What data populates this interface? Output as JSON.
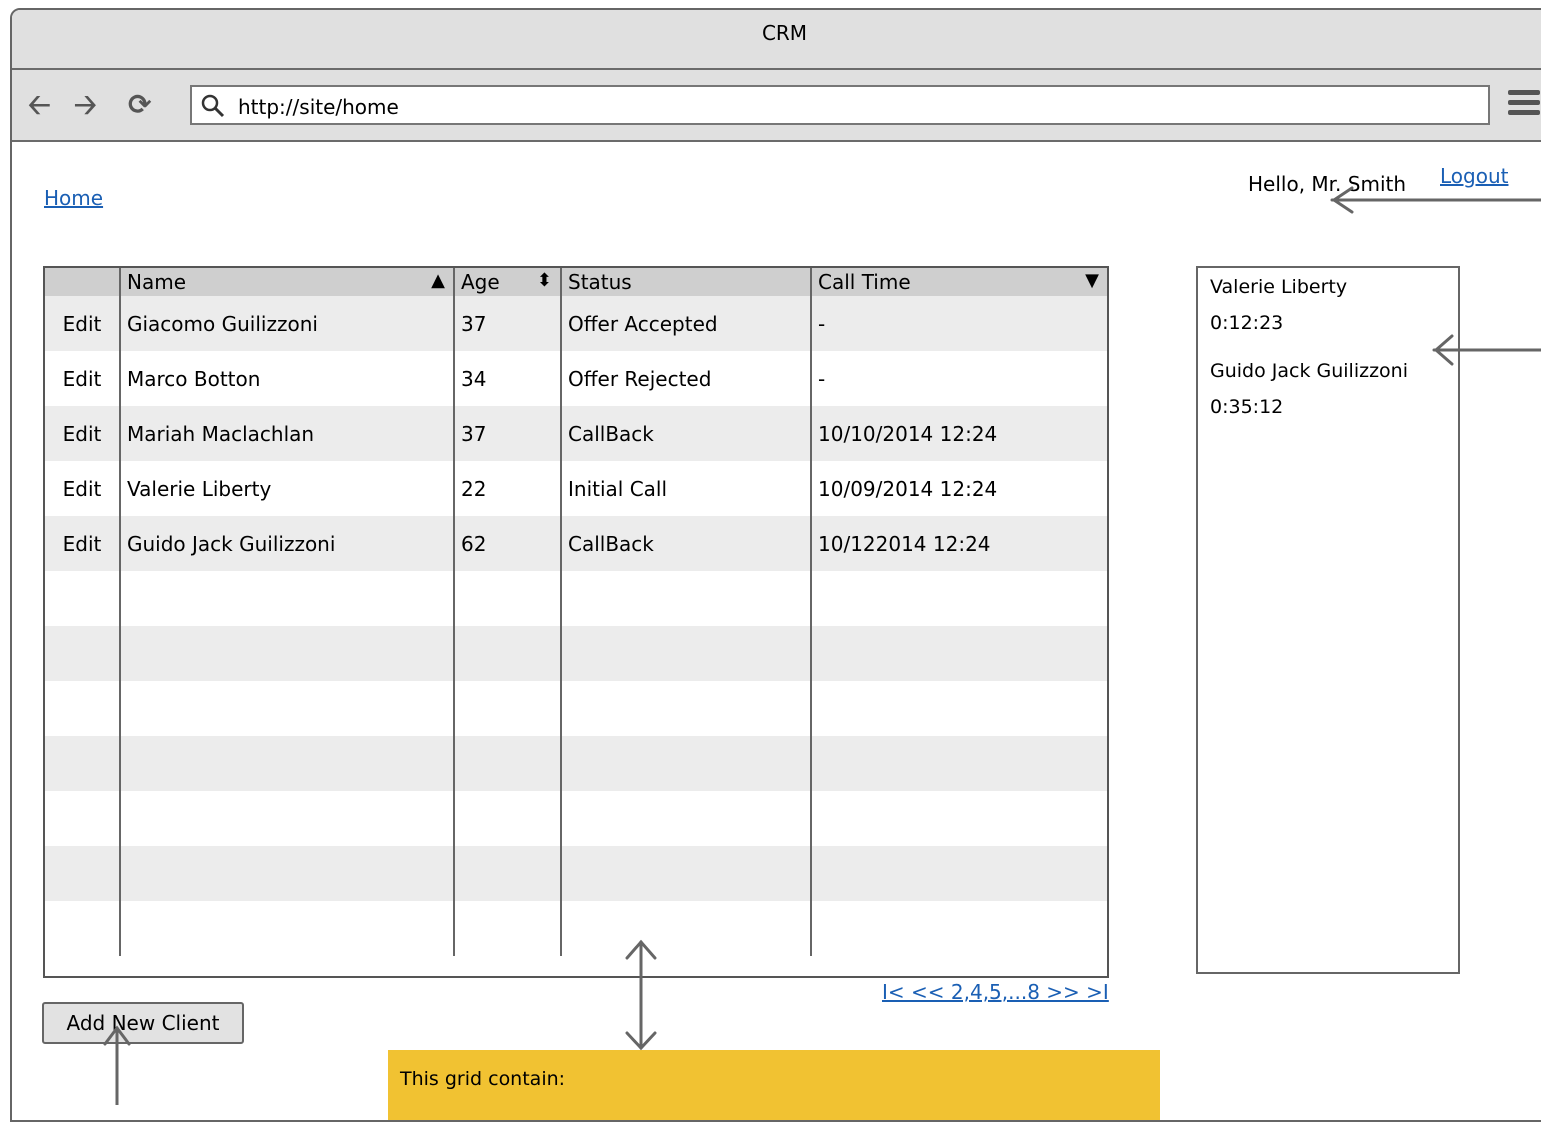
{
  "window": {
    "title": "CRM"
  },
  "toolbar": {
    "url": "http://site/home",
    "back_icon": "arrow-left",
    "forward_icon": "arrow-right",
    "reload_icon": "refresh",
    "menu_icon": "hamburger"
  },
  "page": {
    "breadcrumb": "Home",
    "greeting": "Hello, Mr. Smith",
    "logout": "Logout"
  },
  "grid": {
    "columns": [
      "",
      "Name",
      "Age",
      "Status",
      "Call Time"
    ],
    "sort_icons": {
      "name": "▲",
      "age": "⬍",
      "call_time": "▼"
    },
    "rows": [
      {
        "action": "Edit",
        "name": "Giacomo Guilizzoni",
        "age": "37",
        "status": "Offer Accepted",
        "call_time": "-"
      },
      {
        "action": "Edit",
        "name": "Marco Botton",
        "age": "34",
        "status": "Offer Rejected",
        "call_time": "-"
      },
      {
        "action": "Edit",
        "name": "Mariah Maclachlan",
        "age": "37",
        "status": "CallBack",
        "call_time": "10/10/2014 12:24"
      },
      {
        "action": "Edit",
        "name": "Valerie Liberty",
        "age": "22",
        "status": "Initial Call",
        "call_time": "10/09/2014 12:24"
      },
      {
        "action": "Edit",
        "name": "Guido Jack Guilizzoni",
        "age": "62",
        "status": "CallBack",
        "call_time": "10/122014 12:24"
      }
    ],
    "empty_rows": 7,
    "pager": "I< << 2,4,5,...8 >> >I"
  },
  "add_button": "Add New Client",
  "side_panel": {
    "entries": [
      {
        "name": "Valerie Liberty",
        "time": "0:12:23"
      },
      {
        "name": "Guido Jack Guilizzoni",
        "time": "0:35:12"
      }
    ]
  },
  "note": {
    "text": "This grid contain:",
    "color": "#f1c232"
  }
}
